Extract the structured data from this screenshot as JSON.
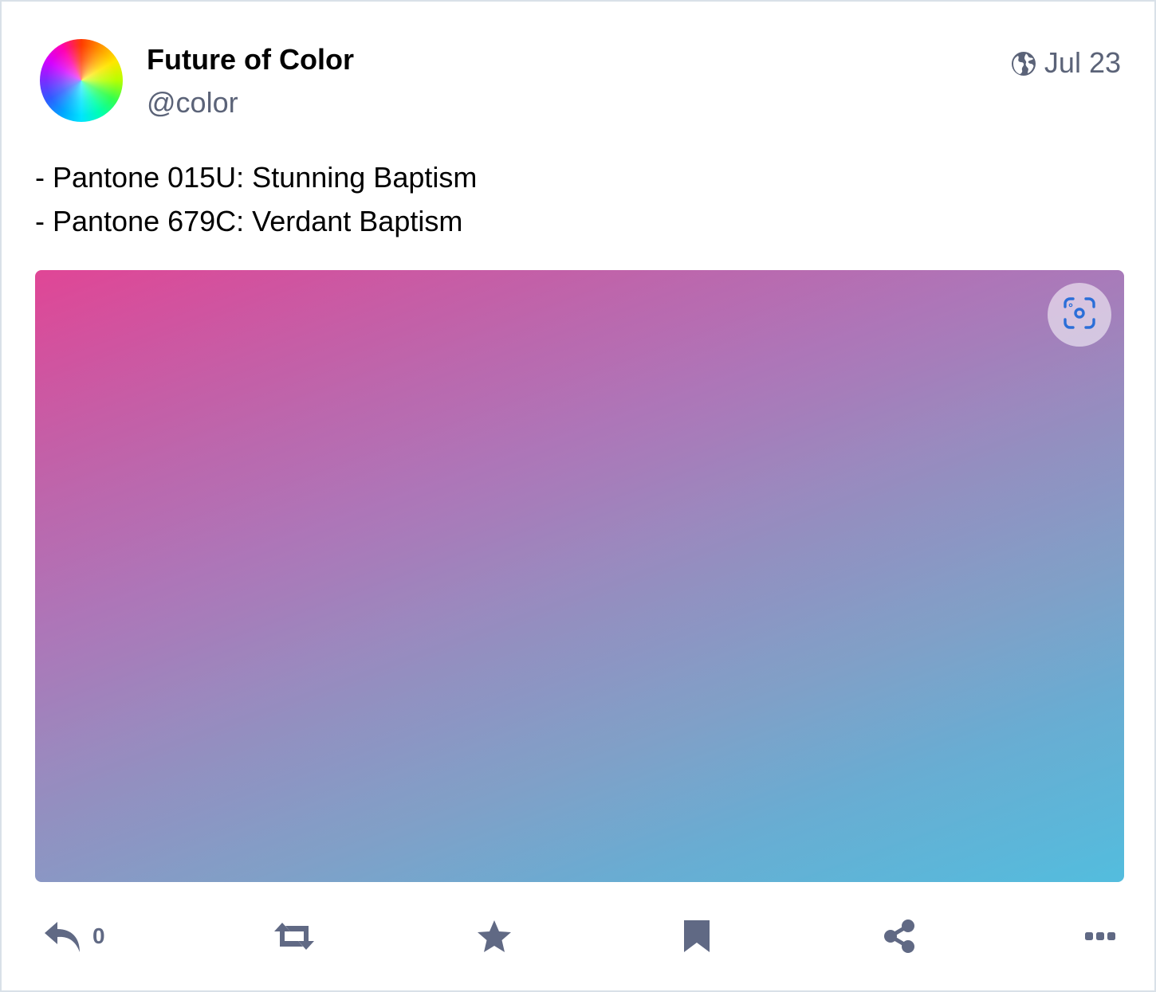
{
  "post": {
    "author": {
      "display_name": "Future of Color",
      "handle": "@color"
    },
    "visibility_icon": "globe-icon",
    "date": "Jul 23",
    "content": [
      "- Pantone 015U: Stunning Baptism",
      "- Pantone 679C: Verdant Baptism"
    ],
    "media": {
      "colors": [
        "#e04696",
        "#ab72b6",
        "#8f8bbe",
        "#53bdde"
      ],
      "ocr_icon": "text-recognition-icon"
    },
    "actions": {
      "reply_icon": "reply-icon",
      "reply_count": "0",
      "boost_icon": "boost-icon",
      "favourite_icon": "star-icon",
      "bookmark_icon": "bookmark-icon",
      "share_icon": "share-icon",
      "more_icon": "more-icon"
    },
    "colors": {
      "muted_text": "#5b6378",
      "action_icons": "#606984",
      "ocr_icon": "#2b6ed8",
      "border": "#d9e1e8"
    }
  }
}
